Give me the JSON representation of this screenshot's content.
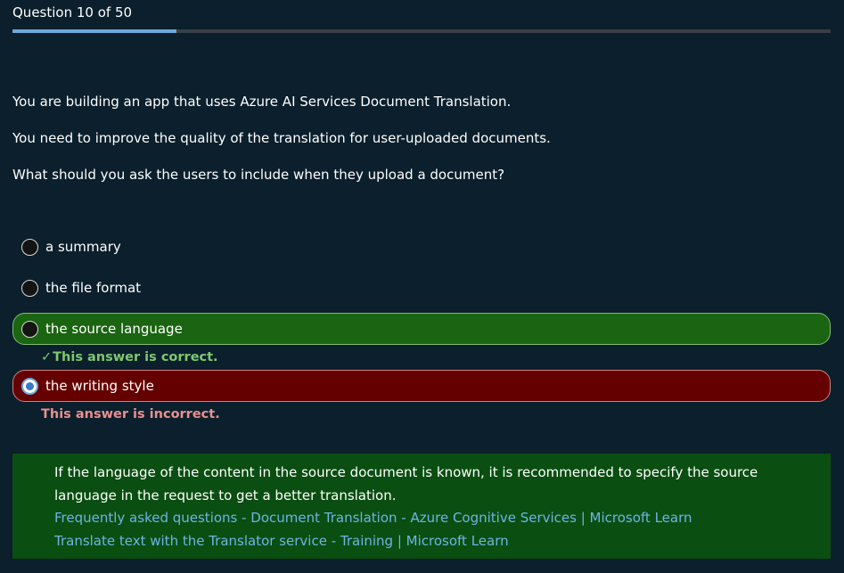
{
  "header": {
    "title": "Question 10 of 50",
    "progress_fraction": 0.2
  },
  "question": {
    "lines": [
      "You are building an app that uses Azure AI Services Document Translation.",
      "You need to improve the quality of the translation for user-uploaded documents.",
      "What should you ask the users to include when they upload a document?"
    ]
  },
  "options": [
    {
      "label": "a summary",
      "selected": false,
      "state": "neutral"
    },
    {
      "label": "the file format",
      "selected": false,
      "state": "neutral"
    },
    {
      "label": "the source language",
      "selected": false,
      "state": "correct"
    },
    {
      "label": "the writing style",
      "selected": true,
      "state": "incorrect"
    }
  ],
  "feedback": {
    "correct": "This answer is correct.",
    "incorrect": "This answer is incorrect.",
    "correct_icon": "check-icon"
  },
  "explanation": {
    "text": "If the language of the content in the source document is known, it is recommended to specify the source language in the request to get a better translation.",
    "links": [
      "Frequently asked questions - Document Translation - Azure Cognitive Services | Microsoft Learn",
      "Translate text with the Translator service - Training | Microsoft Learn"
    ]
  },
  "colors": {
    "background": "#0b1f2c",
    "progress_fill": "#6fa8dc",
    "correct_bg": "#1b6411",
    "incorrect_bg": "#650000",
    "explanation_bg": "#0a4e11",
    "link": "#6fb3e6"
  }
}
